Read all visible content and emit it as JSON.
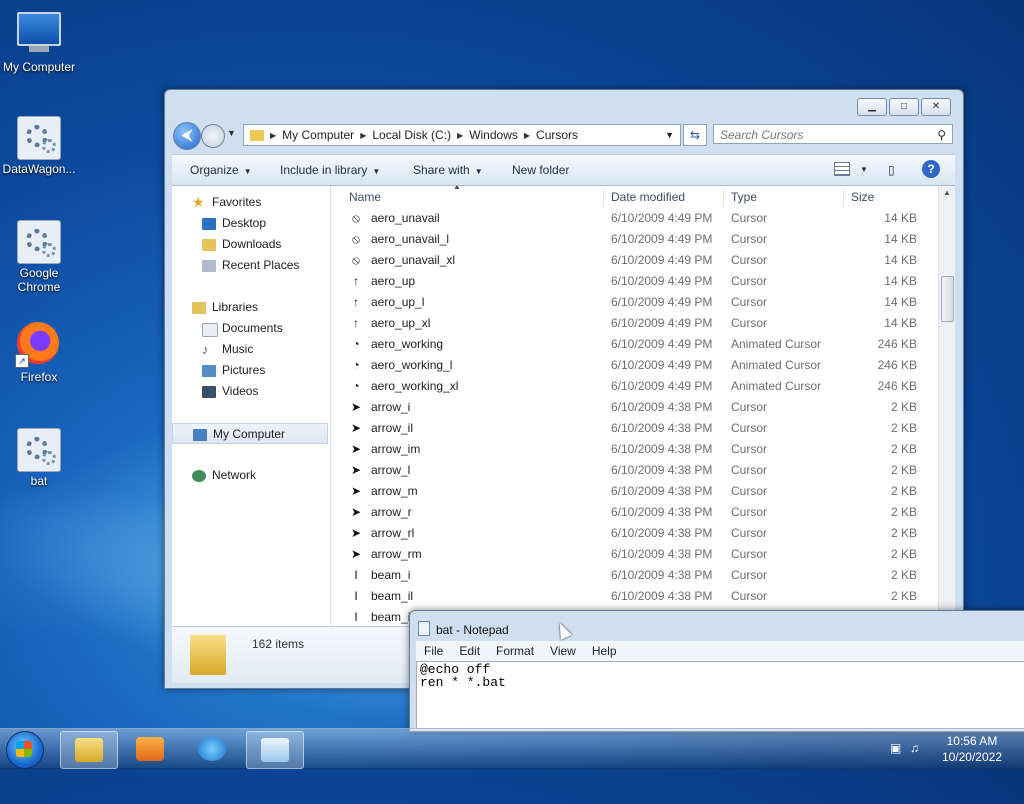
{
  "desktop": {
    "icons": [
      {
        "label": "My Computer"
      },
      {
        "label": "DataWagon..."
      },
      {
        "label": "Google Chrome"
      },
      {
        "label": "Firefox"
      },
      {
        "label": "bat"
      }
    ]
  },
  "explorer": {
    "breadcrumb": [
      "My Computer",
      "Local Disk (C:)",
      "Windows",
      "Cursors"
    ],
    "search_placeholder": "Search Cursors",
    "toolbar": {
      "organize": "Organize",
      "include": "Include in library",
      "share": "Share with",
      "new_folder": "New folder"
    },
    "nav": {
      "favorites": "Favorites",
      "desktop": "Desktop",
      "downloads": "Downloads",
      "recent": "Recent Places",
      "libraries": "Libraries",
      "documents": "Documents",
      "music": "Music",
      "pictures": "Pictures",
      "videos": "Videos",
      "computer": "My Computer",
      "network": "Network"
    },
    "columns": {
      "name": "Name",
      "date": "Date modified",
      "type": "Type",
      "size": "Size"
    },
    "files": [
      {
        "name": "aero_unavail",
        "date": "6/10/2009 4:49 PM",
        "type": "Cursor",
        "size": "14 KB",
        "icon": "⦸"
      },
      {
        "name": "aero_unavail_l",
        "date": "6/10/2009 4:49 PM",
        "type": "Cursor",
        "size": "14 KB",
        "icon": "⦸"
      },
      {
        "name": "aero_unavail_xl",
        "date": "6/10/2009 4:49 PM",
        "type": "Cursor",
        "size": "14 KB",
        "icon": "⦸"
      },
      {
        "name": "aero_up",
        "date": "6/10/2009 4:49 PM",
        "type": "Cursor",
        "size": "14 KB",
        "icon": "↑"
      },
      {
        "name": "aero_up_l",
        "date": "6/10/2009 4:49 PM",
        "type": "Cursor",
        "size": "14 KB",
        "icon": "↑"
      },
      {
        "name": "aero_up_xl",
        "date": "6/10/2009 4:49 PM",
        "type": "Cursor",
        "size": "14 KB",
        "icon": "↑"
      },
      {
        "name": "aero_working",
        "date": "6/10/2009 4:49 PM",
        "type": "Animated Cursor",
        "size": "246 KB",
        "icon": "◔"
      },
      {
        "name": "aero_working_l",
        "date": "6/10/2009 4:49 PM",
        "type": "Animated Cursor",
        "size": "246 KB",
        "icon": "◔"
      },
      {
        "name": "aero_working_xl",
        "date": "6/10/2009 4:49 PM",
        "type": "Animated Cursor",
        "size": "246 KB",
        "icon": "◔"
      },
      {
        "name": "arrow_i",
        "date": "6/10/2009 4:38 PM",
        "type": "Cursor",
        "size": "2 KB",
        "icon": "➤"
      },
      {
        "name": "arrow_il",
        "date": "6/10/2009 4:38 PM",
        "type": "Cursor",
        "size": "2 KB",
        "icon": "➤"
      },
      {
        "name": "arrow_im",
        "date": "6/10/2009 4:38 PM",
        "type": "Cursor",
        "size": "2 KB",
        "icon": "➤"
      },
      {
        "name": "arrow_l",
        "date": "6/10/2009 4:38 PM",
        "type": "Cursor",
        "size": "2 KB",
        "icon": "➤"
      },
      {
        "name": "arrow_m",
        "date": "6/10/2009 4:38 PM",
        "type": "Cursor",
        "size": "2 KB",
        "icon": "➤"
      },
      {
        "name": "arrow_r",
        "date": "6/10/2009 4:38 PM",
        "type": "Cursor",
        "size": "2 KB",
        "icon": "➤"
      },
      {
        "name": "arrow_rl",
        "date": "6/10/2009 4:38 PM",
        "type": "Cursor",
        "size": "2 KB",
        "icon": "➤"
      },
      {
        "name": "arrow_rm",
        "date": "6/10/2009 4:38 PM",
        "type": "Cursor",
        "size": "2 KB",
        "icon": "➤"
      },
      {
        "name": "beam_i",
        "date": "6/10/2009 4:38 PM",
        "type": "Cursor",
        "size": "2 KB",
        "icon": "I"
      },
      {
        "name": "beam_il",
        "date": "6/10/2009 4:38 PM",
        "type": "Cursor",
        "size": "2 KB",
        "icon": "I"
      },
      {
        "name": "beam_im",
        "date": "",
        "type": "",
        "size": "",
        "icon": "I"
      }
    ],
    "status_count": "162 items"
  },
  "notepad": {
    "title": "bat - Notepad",
    "menu": [
      "File",
      "Edit",
      "Format",
      "View",
      "Help"
    ],
    "content": "@echo off\nren * *.bat"
  },
  "taskbar": {
    "clock_time": "10:56 AM",
    "clock_date": "10/20/2022"
  }
}
